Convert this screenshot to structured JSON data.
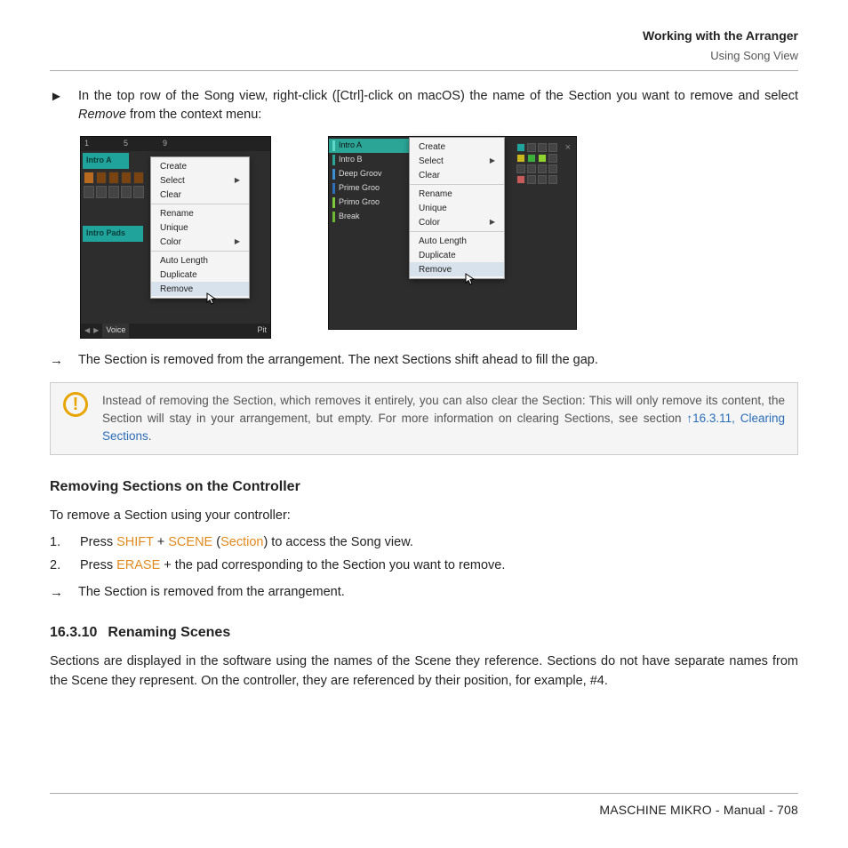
{
  "header": {
    "title": "Working with the Arranger",
    "subtitle": "Using Song View"
  },
  "block1": {
    "symbol": "►",
    "text_a": "In the top row of the Song view, right-click ([Ctrl]-click on macOS) the name of the Section you want to remove and select ",
    "text_em": "Remove",
    "text_b": " from the context menu:"
  },
  "shot1": {
    "ruler": [
      "1",
      "5",
      "9"
    ],
    "tracks": [
      "Intro A",
      "Intro Pads"
    ],
    "menu": [
      "Create",
      "Select",
      "Clear",
      "Rename",
      "Unique",
      "Color",
      "Auto Length",
      "Duplicate",
      "Remove"
    ],
    "submenu_markers": {
      "Select": true,
      "Color": true
    },
    "selected": "Remove",
    "bottombar": {
      "voice": "Voice",
      "pit_suffix": "Pit"
    }
  },
  "shot2": {
    "scenes": [
      "Intro A",
      "Intro B",
      "Deep Groov",
      "Prime Groo",
      "Primo Groo",
      "Break"
    ],
    "selected_scene": "Intro A",
    "menu": [
      "Create",
      "Select",
      "Clear",
      "Rename",
      "Unique",
      "Color",
      "Auto Length",
      "Duplicate",
      "Remove"
    ],
    "submenu_markers": {
      "Select": true,
      "Color": true
    },
    "selected": "Remove"
  },
  "arrow1": {
    "symbol": "→",
    "text": "The Section is removed from the arrangement. The next Sections shift ahead to fill the gap."
  },
  "note": {
    "icon": "!",
    "text_a": "Instead of removing the Section, which removes it entirely, you can also clear the Section: This will only remove its content, the Section will stay in your arrangement, but empty. For more information on clearing Sections, see section ",
    "link": "↑16.3.11, Clearing Sections",
    "text_b": "."
  },
  "heading1": "Removing Sections on the Controller",
  "intro1": "To remove a Section using your controller:",
  "steps": [
    {
      "n": "1.",
      "pre": "Press ",
      "k1": "SHIFT",
      "mid": " + ",
      "k2": "SCENE",
      "paren_open": " (",
      "k3": "Section",
      "paren_close": ") to access the Song view."
    },
    {
      "n": "2.",
      "pre": "Press ",
      "k1": "ERASE",
      "rest": " + the pad corresponding to the Section you want to remove."
    }
  ],
  "arrow2": {
    "symbol": "→",
    "text": "The Section is removed from the arrangement."
  },
  "heading2": {
    "num": "16.3.10",
    "title": "Renaming Scenes"
  },
  "para2": "Sections are displayed in the software using the names of the Scene they reference. Sections do not have separate names from the Scene they represent. On the controller, they are referenced by their position, for example, #4.",
  "footer": "MASCHINE MIKRO - Manual - 708"
}
